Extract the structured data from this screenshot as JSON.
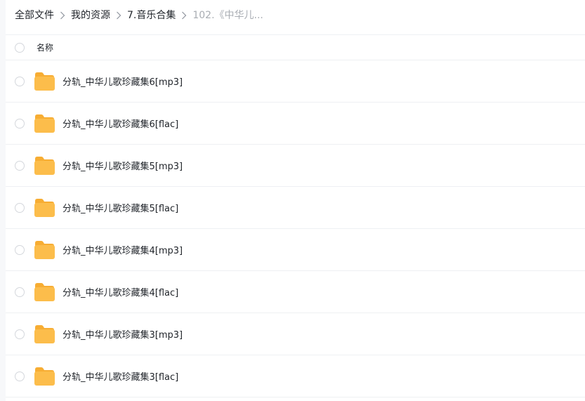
{
  "breadcrumb": {
    "items": [
      "全部文件",
      "我的资源",
      "7.音乐合集"
    ],
    "current": "102.《中华儿..."
  },
  "header": {
    "name_label": "名称"
  },
  "colors": {
    "folder": "#fcbd4b",
    "folder_tab": "#f7ad33",
    "divider": "#eef0f3",
    "muted_text": "#a9adb3"
  },
  "icons": {
    "separator": "chevron-right-icon",
    "folder": "folder-icon",
    "checkbox": "circle-checkbox"
  },
  "files": [
    {
      "name": "分轨_中华儿歌珍藏集6[mp3]"
    },
    {
      "name": "分轨_中华儿歌珍藏集6[flac]"
    },
    {
      "name": "分轨_中华儿歌珍藏集5[mp3]"
    },
    {
      "name": "分轨_中华儿歌珍藏集5[flac]"
    },
    {
      "name": "分轨_中华儿歌珍藏集4[mp3]"
    },
    {
      "name": "分轨_中华儿歌珍藏集4[flac]"
    },
    {
      "name": "分轨_中华儿歌珍藏集3[mp3]"
    },
    {
      "name": "分轨_中华儿歌珍藏集3[flac]"
    }
  ]
}
